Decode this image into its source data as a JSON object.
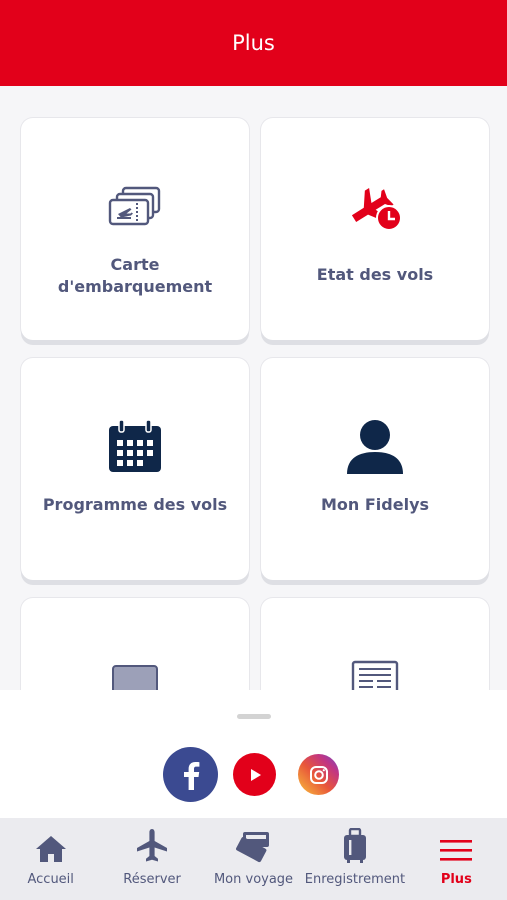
{
  "header": {
    "title": "Plus"
  },
  "cards": [
    {
      "label": "Carte d'embarquement",
      "icon": "boarding-pass-icon"
    },
    {
      "label": "Etat des vols",
      "icon": "flight-status-icon"
    },
    {
      "label": "Programme des vols",
      "icon": "calendar-icon"
    },
    {
      "label": "Mon Fidelys",
      "icon": "user-icon"
    },
    {
      "label": "",
      "icon": "laptop-icon"
    },
    {
      "label": "",
      "icon": "newspaper-icon"
    }
  ],
  "social": [
    {
      "name": "facebook",
      "icon": "facebook-icon",
      "color": "#3b4a91"
    },
    {
      "name": "youtube",
      "icon": "youtube-icon",
      "color": "#e2001a"
    },
    {
      "name": "instagram",
      "icon": "instagram-icon",
      "color": "#c13584"
    }
  ],
  "tabbar": {
    "items": [
      {
        "label": "Accueil",
        "icon": "home-icon"
      },
      {
        "label": "Réserver",
        "icon": "airplane-icon"
      },
      {
        "label": "Mon voyage",
        "icon": "tickets-icon"
      },
      {
        "label": "Enregistrement",
        "icon": "luggage-icon"
      },
      {
        "label": "Plus",
        "icon": "menu-icon",
        "active": true
      }
    ]
  },
  "colors": {
    "brand_red": "#e2001a",
    "navy": "#0f2749",
    "label": "#52587c"
  }
}
